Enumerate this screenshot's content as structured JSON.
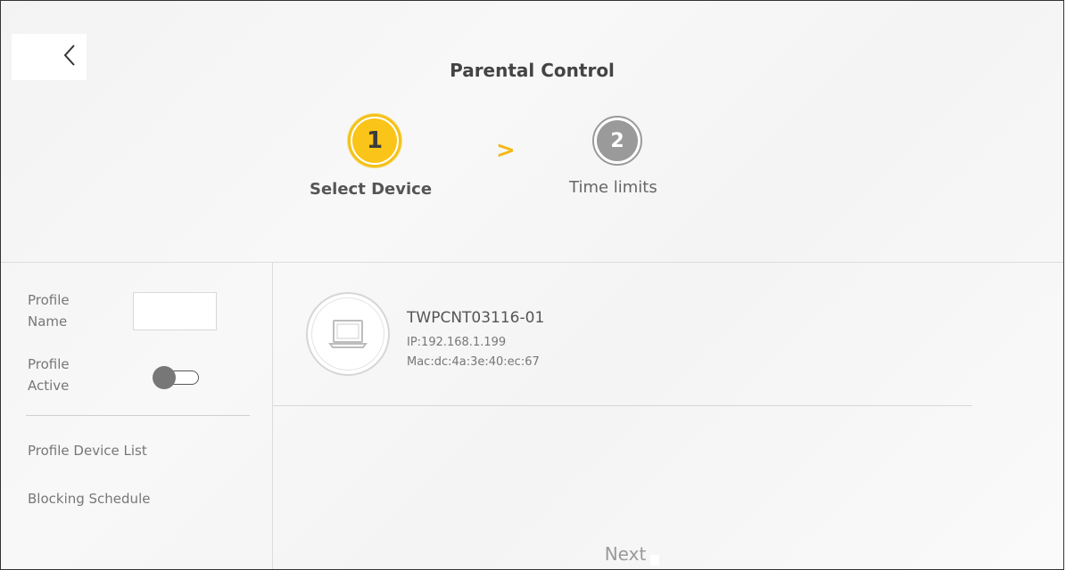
{
  "header": {
    "title": "Parental Control"
  },
  "stepper": {
    "steps": [
      {
        "number": "1",
        "label": "Select Device",
        "active": true
      },
      {
        "number": "2",
        "label": "Time limits",
        "active": false
      }
    ],
    "separator": ">"
  },
  "sidebar": {
    "profile_name_label": "Profile Name",
    "profile_name_value": "",
    "profile_active_label": "Profile Active",
    "profile_active": false,
    "links": [
      {
        "label": "Profile Device List"
      },
      {
        "label": "Blocking Schedule"
      }
    ]
  },
  "device": {
    "name": "TWPCNT03116-01",
    "ip": "IP:192.168.1.199",
    "mac": "Mac:dc:4a:3e:40:ec:67",
    "icon": "laptop-icon"
  },
  "footer": {
    "next_label": "Next"
  },
  "colors": {
    "active_step": "#fbc418",
    "inactive_step": "#9a9a9a",
    "arrow": "#f3b814"
  }
}
